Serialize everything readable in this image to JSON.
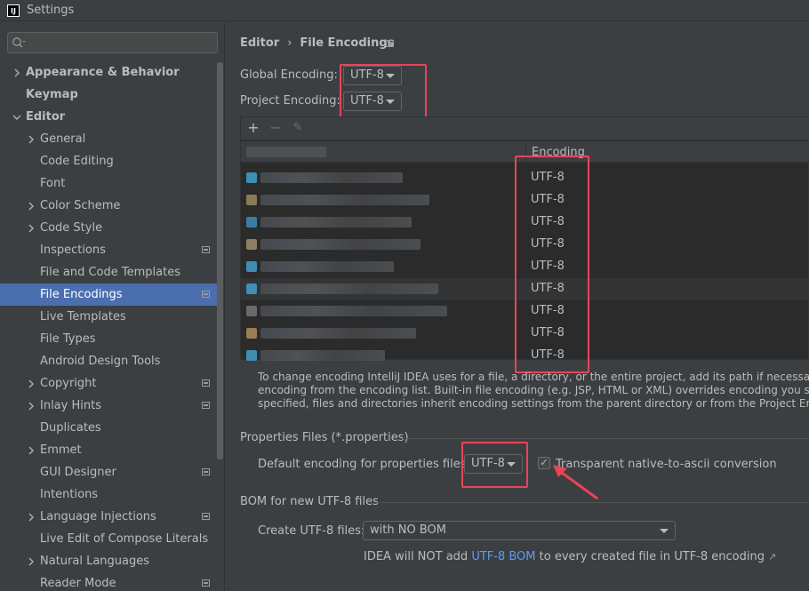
{
  "window": {
    "title": "Settings",
    "app_icon_text": "IJ"
  },
  "search": {
    "placeholder": ""
  },
  "sidebar": {
    "items": [
      {
        "label": "Appearance & Behavior",
        "bold": true,
        "arrow": "right",
        "indent": 0
      },
      {
        "label": "Keymap",
        "bold": true,
        "arrow": "none",
        "indent": 0
      },
      {
        "label": "Editor",
        "bold": true,
        "arrow": "down",
        "indent": 0
      },
      {
        "label": "General",
        "arrow": "right",
        "indent": 1
      },
      {
        "label": "Code Editing",
        "arrow": "none",
        "indent": 1
      },
      {
        "label": "Font",
        "arrow": "none",
        "indent": 1
      },
      {
        "label": "Color Scheme",
        "arrow": "right",
        "indent": 1
      },
      {
        "label": "Code Style",
        "arrow": "right",
        "indent": 1
      },
      {
        "label": "Inspections",
        "arrow": "none",
        "indent": 1,
        "project": true
      },
      {
        "label": "File and Code Templates",
        "arrow": "none",
        "indent": 1
      },
      {
        "label": "File Encodings",
        "arrow": "none",
        "indent": 1,
        "project": true,
        "selected": true
      },
      {
        "label": "Live Templates",
        "arrow": "none",
        "indent": 1
      },
      {
        "label": "File Types",
        "arrow": "none",
        "indent": 1
      },
      {
        "label": "Android Design Tools",
        "arrow": "none",
        "indent": 1
      },
      {
        "label": "Copyright",
        "arrow": "right",
        "indent": 1,
        "project": true
      },
      {
        "label": "Inlay Hints",
        "arrow": "right",
        "indent": 1,
        "project": true
      },
      {
        "label": "Duplicates",
        "arrow": "none",
        "indent": 1
      },
      {
        "label": "Emmet",
        "arrow": "right",
        "indent": 1
      },
      {
        "label": "GUI Designer",
        "arrow": "none",
        "indent": 1,
        "project": true
      },
      {
        "label": "Intentions",
        "arrow": "none",
        "indent": 1
      },
      {
        "label": "Language Injections",
        "arrow": "right",
        "indent": 1,
        "project": true
      },
      {
        "label": "Live Edit of Compose Literals",
        "arrow": "none",
        "indent": 1
      },
      {
        "label": "Natural Languages",
        "arrow": "right",
        "indent": 1
      },
      {
        "label": "Reader Mode",
        "arrow": "none",
        "indent": 1,
        "project": true
      }
    ]
  },
  "breadcrumb": {
    "parent": "Editor",
    "separator": "›",
    "current": "File Encodings"
  },
  "global_encoding": {
    "label": "Global Encoding:",
    "value": "UTF-8"
  },
  "project_encoding": {
    "label": "Project Encoding:",
    "value": "UTF-8"
  },
  "table": {
    "toolbar": {
      "add": "+",
      "remove": "−",
      "edit": "✎"
    },
    "encoding_header": "Encoding",
    "rows": [
      {
        "encoding": "UTF-8",
        "icon_color": "#3d8fb3",
        "blur_width": 160
      },
      {
        "encoding": "UTF-8",
        "icon_color": "#8a7a5a",
        "blur_width": 190
      },
      {
        "encoding": "UTF-8",
        "icon_color": "#3a7da3",
        "blur_width": 170
      },
      {
        "encoding": "UTF-8",
        "icon_color": "#8c8062",
        "blur_width": 180
      },
      {
        "encoding": "UTF-8",
        "icon_color": "#3d8fb3",
        "blur_width": 150
      },
      {
        "encoding": "UTF-8",
        "icon_color": "#3d8fb3",
        "blur_width": 200
      },
      {
        "encoding": "UTF-8",
        "icon_color": "#6a6a6a",
        "blur_width": 210
      },
      {
        "encoding": "UTF-8",
        "icon_color": "#9a7f52",
        "blur_width": 175
      },
      {
        "encoding": "UTF-8",
        "icon_color": "#3d8fb3",
        "blur_width": 140
      }
    ]
  },
  "info_text": [
    "To change encoding IntelliJ IDEA uses for a file, a directory, or the entire project, add its path if necessary and then select",
    "encoding from the encoding list. Built-in file encoding (e.g. JSP, HTML or XML) overrides encoding you specify here. If not",
    "specified, files and directories inherit encoding settings from the parent directory or from the Project Encoding."
  ],
  "properties": {
    "section_title": "Properties Files (*.properties)",
    "default_label": "Default encoding for properties files:",
    "default_value": "UTF-8",
    "checkbox_label": "Transparent native-to-ascii conversion",
    "checkbox_checked": true
  },
  "bom": {
    "section_title": "BOM for new UTF-8 files",
    "create_label": "Create UTF-8 files:",
    "create_value": "with NO BOM",
    "note_prefix": "IDEA will NOT add",
    "note_link": "UTF-8 BOM",
    "note_suffix": "to every created file in UTF-8 encoding",
    "note_arrow": "↗"
  },
  "colors": {
    "highlight": "#e8445a",
    "selection": "#4b6eaf",
    "link": "#589df6",
    "background": "#3c3f41"
  }
}
